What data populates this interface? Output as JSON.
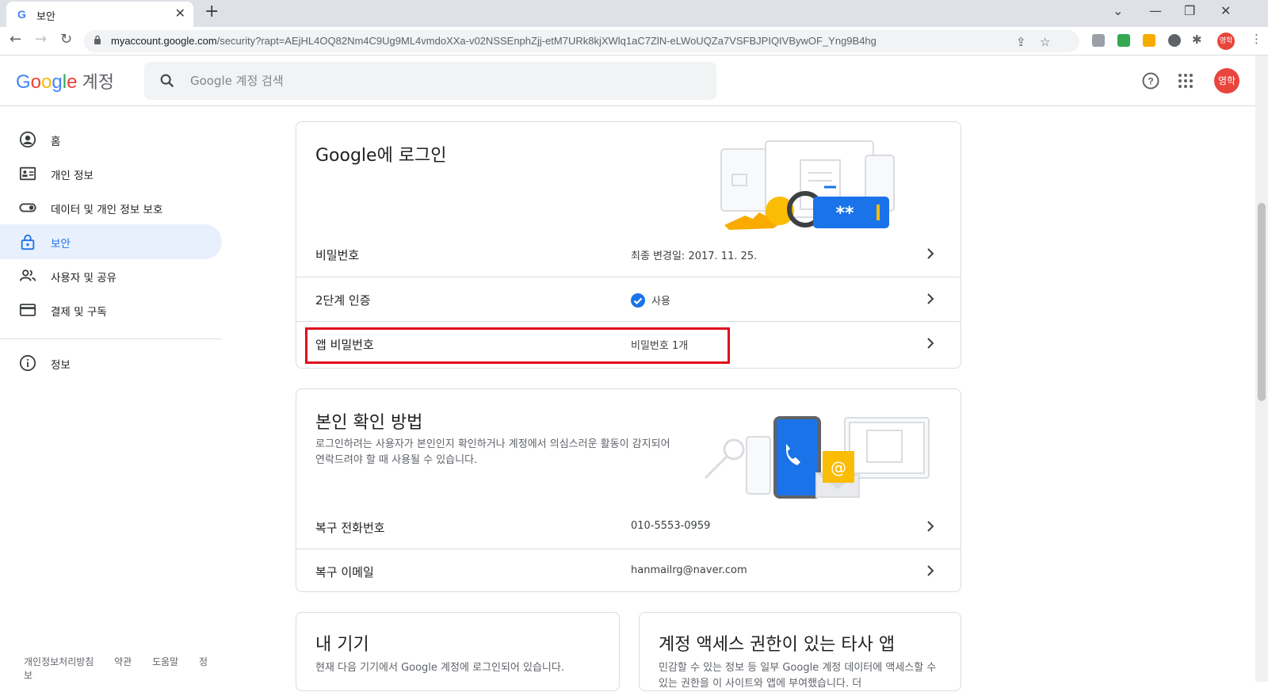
{
  "browser": {
    "tab_title": "보안",
    "tab_favicon": "G",
    "url_host": "myaccount.google.com",
    "url_path": "/security?rapt=AEjHL4OQ82Nm4C9Ug9ML4vmdoXXa-v02NSSEnphZjj-etM7URk8kjXWlq1aC7ZlN-eLWoUQZa7VSFBJPIQIVBywOF_Yng9B4hg",
    "profile_initials": "영학"
  },
  "header": {
    "logo_parts": [
      "G",
      "o",
      "o",
      "g",
      "l",
      "e"
    ],
    "account_label": "계정",
    "search_placeholder": "Google 계정 검색",
    "avatar_initials": "영학"
  },
  "sidebar": {
    "items": [
      {
        "label": "홈",
        "icon": "account-circle-icon"
      },
      {
        "label": "개인 정보",
        "icon": "id-card-icon"
      },
      {
        "label": "데이터 및 개인 정보 보호",
        "icon": "toggle-icon"
      },
      {
        "label": "보안",
        "icon": "lock-icon"
      },
      {
        "label": "사용자 및 공유",
        "icon": "people-icon"
      },
      {
        "label": "결제 및 구독",
        "icon": "credit-card-icon"
      }
    ],
    "info_label": "정보",
    "footer": [
      "개인정보처리방침",
      "약관",
      "도움말",
      "정보"
    ]
  },
  "signin_card": {
    "title": "Google에 로그인",
    "rows": [
      {
        "label": "비밀번호",
        "value": "최종 변경일: 2017. 11. 25."
      },
      {
        "label": "2단계 인증",
        "value": "사용"
      },
      {
        "label": "앱 비밀번호",
        "value": "비밀번호 1개"
      }
    ],
    "illustration_text": "**"
  },
  "verify_card": {
    "title": "본인 확인 방법",
    "description": "로그인하려는 사용자가 본인인지 확인하거나 계정에서 의심스러운 활동이 감지되어 연락드려야 할 때 사용될 수 있습니다.",
    "rows": [
      {
        "label": "복구 전화번호",
        "value": "010-5553-0959"
      },
      {
        "label": "복구 이메일",
        "value": "hanmailrg@naver.com"
      }
    ]
  },
  "devices_card": {
    "title": "내 기기",
    "description": "현재 다음 기기에서 Google 계정에 로그인되어 있습니다."
  },
  "thirdparty_card": {
    "title": "계정 액세스 권한이 있는 타사 앱",
    "description": "민감할 수 있는 정보 등 일부 Google 계정 데이터에 액세스할 수 있는 권한을 이 사이트와 앱에 부여했습니다. 더"
  },
  "colors": {
    "accent": "#1a73e8",
    "highlight": "#e00b1c",
    "avatar": "#e8453c"
  }
}
